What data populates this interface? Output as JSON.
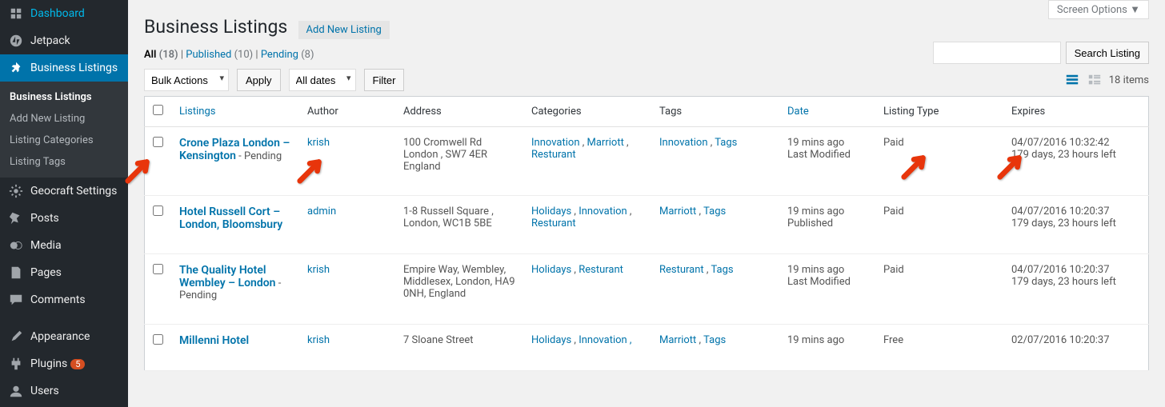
{
  "header": {
    "screen_options": "Screen Options",
    "page_title": "Business Listings",
    "add_new": "Add New Listing",
    "search_button": "Search Listing",
    "items_count": "18 items"
  },
  "sidebar": {
    "dashboard": "Dashboard",
    "jetpack": "Jetpack",
    "business_listings": "Business Listings",
    "geocraft": "Geocraft Settings",
    "posts": "Posts",
    "media": "Media",
    "pages": "Pages",
    "comments": "Comments",
    "appearance": "Appearance",
    "plugins": "Plugins",
    "plugins_count": "5",
    "users": "Users",
    "submenu": {
      "listings": "Business Listings",
      "add_new": "Add New Listing",
      "categories": "Listing Categories",
      "tags": "Listing Tags"
    }
  },
  "filters": {
    "all_label": "All",
    "all_count": "(18)",
    "published_label": "Published",
    "published_count": "(10)",
    "pending_label": "Pending",
    "pending_count": "(8)",
    "sep": " | "
  },
  "actions": {
    "bulk": "Bulk Actions",
    "apply": "Apply",
    "all_dates": "All dates",
    "filter": "Filter"
  },
  "columns": {
    "listings": "Listings",
    "author": "Author",
    "address": "Address",
    "categories": "Categories",
    "tags": "Tags",
    "date": "Date",
    "listing_type": "Listing Type",
    "expires": "Expires"
  },
  "rows": [
    {
      "title": "Crone Plaza London – Kensington",
      "status": " - Pending",
      "author": "krish",
      "address": "100 Cromwell Rd London , SW7 4ER England",
      "categories": "Innovation , Marriott , Resturant",
      "tags": "Innovation , Tags",
      "date_line1": "19 mins ago",
      "date_line2": "Last Modified",
      "listing_type": "Paid",
      "expires_line1": "04/07/2016 10:32:42",
      "expires_line2": "179 days, 23 hours left"
    },
    {
      "title": "Hotel Russell Cort – London, Bloomsbury",
      "status": "",
      "author": "admin",
      "address": "1-8 Russell Square , London, WC1B 5BE",
      "categories": "Holidays , Innovation , Resturant",
      "tags": "Marriott , Tags",
      "date_line1": "19 mins ago",
      "date_line2": "Published",
      "listing_type": "Paid",
      "expires_line1": "04/07/2016 10:20:37",
      "expires_line2": "179 days, 23 hours left"
    },
    {
      "title": "The Quality Hotel Wembley – London",
      "status": " - Pending",
      "author": "krish",
      "address": "Empire Way, Wembley, Middlesex, London, HA9 0NH, England",
      "categories": "Holidays , Resturant",
      "tags": "Resturant , Tags",
      "date_line1": "19 mins ago",
      "date_line2": "Last Modified",
      "listing_type": "Paid",
      "expires_line1": "04/07/2016 10:20:37",
      "expires_line2": "179 days, 23 hours left"
    },
    {
      "title": "Millenni Hotel",
      "status": "",
      "author": "krish",
      "address": "7 Sloane Street",
      "categories": "Holidays , Innovation ,",
      "tags": "Marriott , Tags",
      "date_line1": "19 mins ago",
      "date_line2": "",
      "listing_type": "Free",
      "expires_line1": "02/07/2016 10:20:37",
      "expires_line2": ""
    }
  ]
}
